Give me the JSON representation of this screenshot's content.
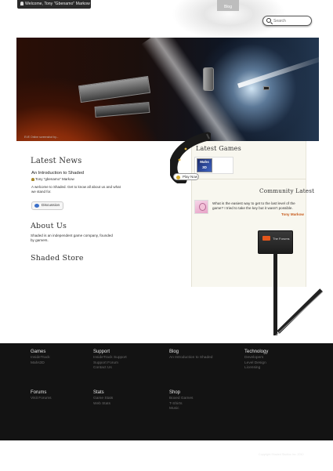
{
  "topbar": {
    "welcome": "Welcome, Tony \"Gbenamo\" Markow",
    "nav_blog": "Blog",
    "search_placeholder": "Search"
  },
  "hero": {
    "caption": "EVE Online screenshot by..."
  },
  "news": {
    "heading": "Latest News",
    "post_title": "An Introduction to Shaded",
    "post_author": "Tony \"gbenamo\" Markow",
    "post_excerpt": "A welcome to Shaded. Get to know all about us and what we stand for.",
    "discussion": "Discussion"
  },
  "about": {
    "heading": "About Us",
    "text": "Shaded is an independent game company, founded by gamers."
  },
  "store": {
    "heading": "Shaded Store"
  },
  "games": {
    "heading": "Latest Games",
    "thumb_label": "Mahs 3D",
    "play_now": "Play Now"
  },
  "community": {
    "heading": "Community Latest",
    "quote": "What is the easiest way to get to the last level of the game? I tried to take the key but it wasn't possible.",
    "author": "Tony Markow"
  },
  "signpost": {
    "label": "The Forums"
  },
  "footer": {
    "columns": [
      {
        "title": "Games",
        "links": [
          "InsideTrack",
          "Mahs3D"
        ]
      },
      {
        "title": "Support",
        "links": [
          "InsideTrack Support",
          "Support Forum",
          "Contact Us"
        ]
      },
      {
        "title": "Blog",
        "links": [
          "An Introduction to Shaded"
        ]
      },
      {
        "title": "Technology",
        "links": [
          "Developers",
          "Level Design",
          "Licensing"
        ]
      },
      {
        "title": "Forums",
        "links": [
          "Visit Forums"
        ]
      },
      {
        "title": "Stats",
        "links": [
          "Game Stats",
          "Web Stats"
        ]
      },
      {
        "title": "Shop",
        "links": [
          "Boxed Games",
          "T-Shirts",
          "Music"
        ]
      }
    ],
    "copyright": "Copyright Shaded Studios Inc. 2010"
  },
  "colors": {
    "accent": "#c75b1c",
    "footer_bg": "#131313",
    "panel_bg": "#f8f7ef",
    "signpost_tag": "#e4571c"
  }
}
